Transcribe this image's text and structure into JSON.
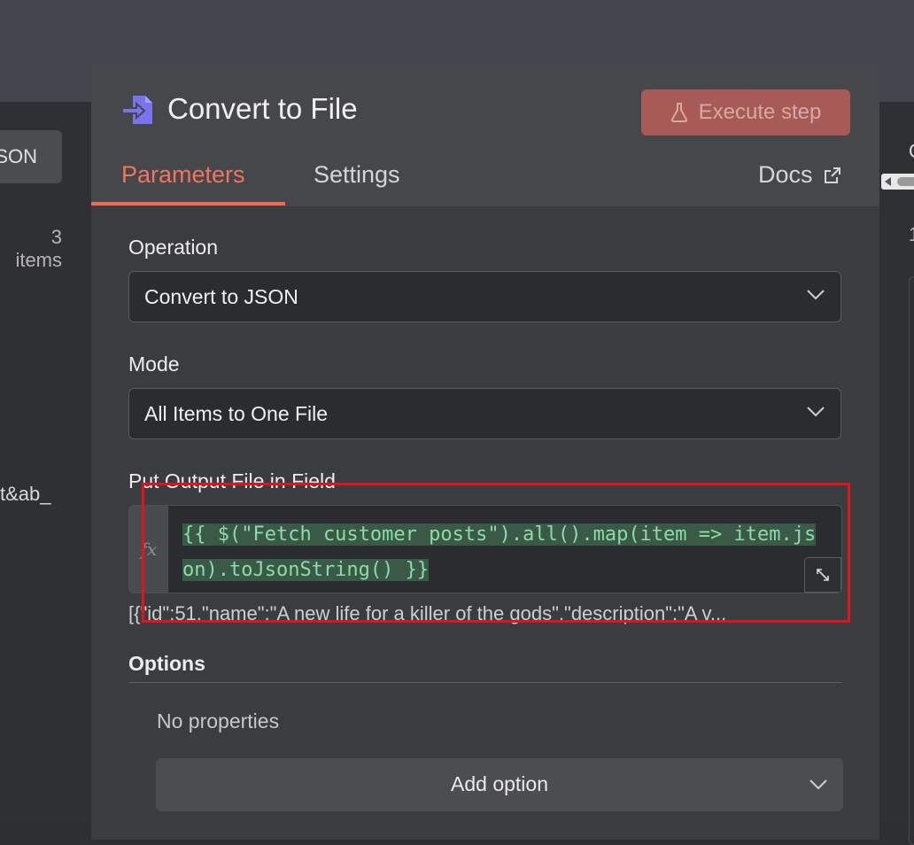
{
  "background": {
    "left_chip_label": "JSON",
    "left_items_text": "3 items",
    "left_fragment": "t&ab_",
    "right_fragment_1": "O",
    "right_fragment_2": "1"
  },
  "modal": {
    "title": "Convert to File",
    "icon": "file-import-icon",
    "execute_label": "Execute step",
    "tabs": [
      {
        "label": "Parameters",
        "active": true
      },
      {
        "label": "Settings",
        "active": false
      },
      {
        "label": "Docs",
        "active": false
      }
    ],
    "operation": {
      "label": "Operation",
      "value": "Convert to JSON"
    },
    "mode": {
      "label": "Mode",
      "value": "All Items to One File"
    },
    "output_field": {
      "label": "Put Output File in Field",
      "expression": "{{ $(\"Fetch customer posts\").all().map(item => item.json).toJsonString() }}",
      "fx_label": "fx",
      "result_preview": "[{\"id\":51,\"name\":\"A new life for a killer of the gods\",\"description\":\"A v..."
    },
    "options": {
      "title": "Options",
      "empty_text": "No properties",
      "add_label": "Add option"
    }
  },
  "colors": {
    "accent": "#ee6c54",
    "execute_bg": "#a85a56",
    "expression_text": "#8cdba8",
    "highlight": "#e0141c"
  }
}
